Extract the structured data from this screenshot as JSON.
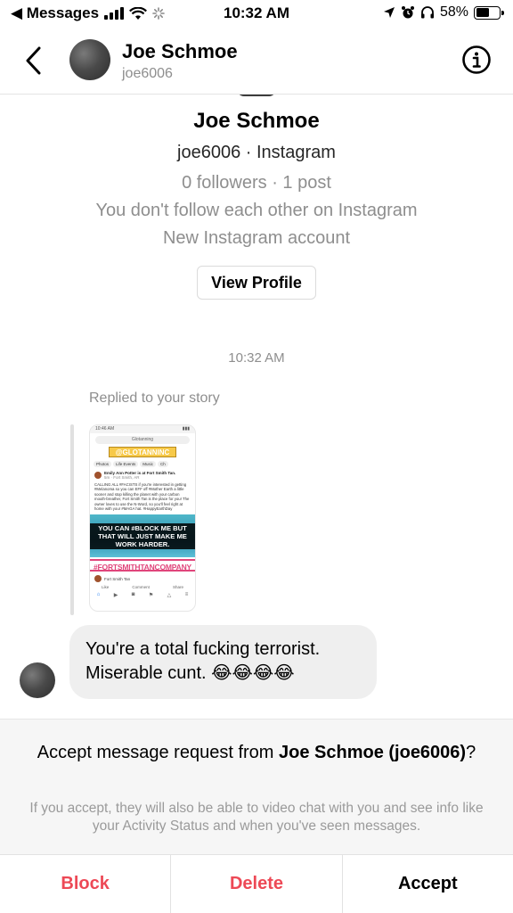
{
  "status_bar": {
    "back_app": "◀ Messages",
    "time": "10:32 AM",
    "battery_percent": "58%",
    "battery_level": 0.58
  },
  "header": {
    "name": "Joe Schmoe",
    "username": "joe6006"
  },
  "profile": {
    "name": "Joe Schmoe",
    "handle_line": "joe6006 · Instagram",
    "stats_line": "0 followers · 1 post",
    "follow_line": "You don't follow each other on Instagram",
    "new_account_line": "New Instagram account",
    "view_profile_label": "View Profile"
  },
  "conversation": {
    "timestamp": "10:32 AM",
    "reply_label": "Replied to your story",
    "story": {
      "status_time": "10:46 AM",
      "search_text": "Glotanning",
      "sticker": "@GLOTANNINC",
      "chips": [
        "Photos",
        "Life Events",
        "Music",
        "Ch"
      ],
      "post_author": "Emily Ann Potter is at Fort Smith Tan.",
      "post_meta": "5m · Fort Smith, AR",
      "post_text": "CALLING ALL #FACISTS if you're interested in getting #Melanoma so you can EFF off #Mother Earth a little sooner and stop killing the planet with your carbon mouth-breather, Fort Smith Tan is the place for you! The owner loves to use the N-Word, so you'll feel right at home with your #MAGA hat. #HappyEarthDay",
      "overlay_text": "YOU CAN #BLOCK ME BUT THAT WILL JUST MAKE ME WORK HARDER.",
      "tag_text": "#FORTSMITHTANCOMPANY",
      "page_name": "Fort Smith Tan",
      "like_label": "Like",
      "comment_label": "Comment",
      "share_label": "Share"
    },
    "message_text": "You're a total fucking terrorist. Miserable cunt. 😂😂😂😂"
  },
  "request": {
    "title_prefix": "Accept message request from ",
    "title_name": "Joe Schmoe (joe6006)",
    "title_suffix": "?",
    "body": "If you accept, they will also be able to video chat with you and see info like your Activity Status and when you've seen messages."
  },
  "actions": {
    "block": "Block",
    "delete": "Delete",
    "accept": "Accept"
  },
  "colors": {
    "danger": "#ed4956",
    "muted": "#8e8e8e",
    "bubble": "#efefef"
  }
}
